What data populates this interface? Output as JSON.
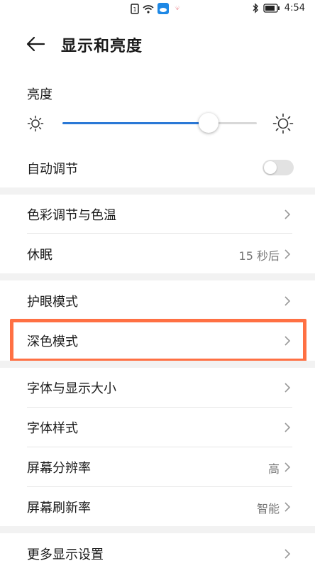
{
  "status_bar": {
    "time": "4:54",
    "icons": [
      "sim-card-icon",
      "wifi-icon",
      "cloud-app-icon",
      "huawei-logo-icon",
      "bluetooth-icon",
      "battery-icon"
    ]
  },
  "header": {
    "title": "显示和亮度",
    "back_icon": "arrow-left-icon"
  },
  "brightness": {
    "label": "亮度",
    "level": 0.75,
    "accent": "#2a78d6"
  },
  "auto_adjust": {
    "label": "自动调节",
    "enabled": false
  },
  "groups": [
    {
      "items": [
        {
          "label": "色彩调节与色温",
          "value": ""
        },
        {
          "label": "休眠",
          "value": "15 秒后"
        }
      ]
    },
    {
      "items": [
        {
          "label": "护眼模式",
          "value": ""
        },
        {
          "label": "深色模式",
          "value": "",
          "highlighted": true
        }
      ]
    },
    {
      "items": [
        {
          "label": "字体与显示大小",
          "value": ""
        },
        {
          "label": "字体样式",
          "value": ""
        },
        {
          "label": "屏幕分辨率",
          "value": "高"
        },
        {
          "label": "屏幕刷新率",
          "value": "智能"
        }
      ]
    },
    {
      "items": [
        {
          "label": "更多显示设置",
          "value": ""
        }
      ]
    }
  ],
  "highlight_color": "#ff7043"
}
